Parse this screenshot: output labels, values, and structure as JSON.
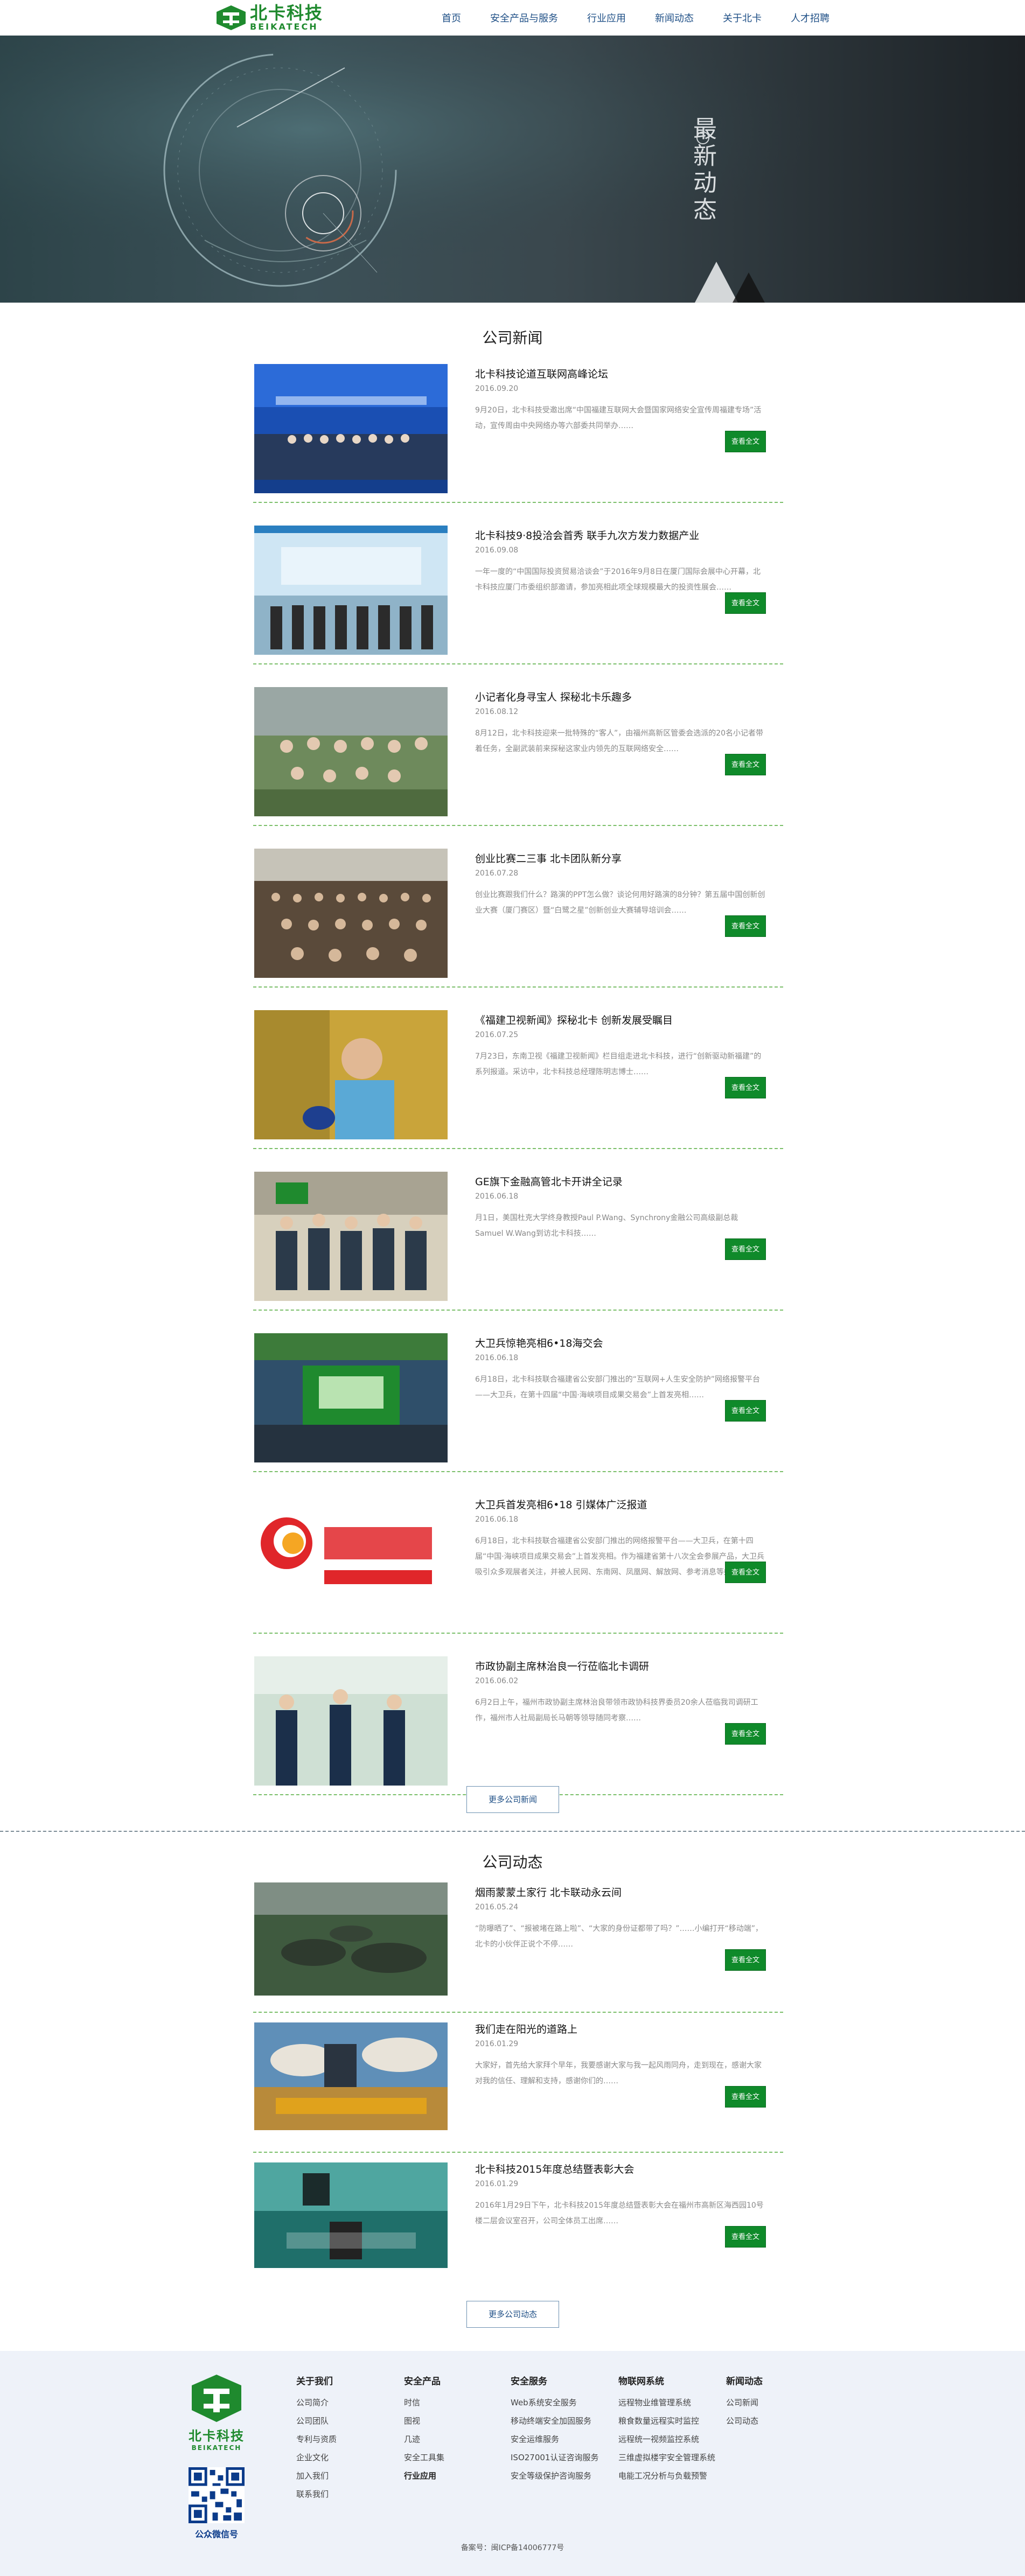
{
  "brand": {
    "name_cn": "北卡科技",
    "name_en": "BEIKATECH"
  },
  "nav": [
    {
      "label": "首页"
    },
    {
      "label": "安全产品与服务"
    },
    {
      "label": "行业应用"
    },
    {
      "label": "新闻动态"
    },
    {
      "label": "关于北卡"
    },
    {
      "label": "人才招聘"
    }
  ],
  "banner": {
    "title": "最新动态"
  },
  "company_news": {
    "title": "公司新闻",
    "more_label": "更多公司新闻",
    "read_label": "查看全文",
    "items": [
      {
        "title": "北卡科技论道互联网高峰论坛",
        "date": "2016.09.20",
        "summary": "9月20日，北卡科技受邀出席“中国福建互联网大会暨国家网络安全宣传周福建专场”活动，宣传周由中央网络办等六部委共同举办……"
      },
      {
        "title": "北卡科技9·8投洽会首秀  联手九次方发力数据产业",
        "date": "2016.09.08",
        "summary": "一年一度的“中国国际投资贸易洽谈会”于2016年9月8日在厦门国际会展中心开幕，北卡科技应厦门市委组织部邀请，参加亮相此项全球规模最大的投资性展会……"
      },
      {
        "title": "小记者化身寻宝人  探秘北卡乐趣多",
        "date": "2016.08.12",
        "summary": "8月12日，北卡科技迎来一批特殊的“客人”，由福州高新区管委会选派的20名小记者带着任务，全副武装前来探秘这家业内领先的互联网络安全……"
      },
      {
        "title": "创业比赛二三事  北卡团队新分享",
        "date": "2016.07.28",
        "summary": "创业比赛跟我们什么？路演的PPT怎么做？谈论何用好路演的8分钟？第五届中国创新创业大赛（厦门赛区）暨“白鹭之星”创新创业大赛辅导培训会……"
      },
      {
        "title": "《福建卫视新闻》探秘北卡  创新发展受瞩目",
        "date": "2016.07.25",
        "summary": "7月23日，东南卫视《福建卫视新闻》栏目组走进北卡科技，进行“创新驱动新福建”的系列报道。采访中，北卡科技总经理陈明志博士……"
      },
      {
        "title": "GE旗下金融高管北卡开讲全记录",
        "date": "2016.06.18",
        "summary": "月1日，美国杜克大学终身教授Paul P.Wang、Synchrony金融公司高级副总裁Samuel W.Wang到访北卡科技……"
      },
      {
        "title": "大卫兵惊艳亮相6•18海交会",
        "date": "2016.06.18",
        "summary": "6月18日，北卡科技联合福建省公安部门推出的“互联网+人生安全防护”网络报警平台——大卫兵，在第十四届“中国·海峡项目成果交易会”上首发亮相……"
      },
      {
        "title": "大卫兵首发亮相6•18 引媒体广泛报道",
        "date": "2016.06.18",
        "summary": "6月18日，北卡科技联合福建省公安部门推出的网络报警平台——大卫兵，在第十四届“中国·海峡项目成果交易会”上首发亮相。作为福建省第十八次全会参展产品，大卫兵吸引众多观展者关注，并被人民网、东南网、凤凰网、解放网、参考消息等媒体广泛报道与转载……"
      },
      {
        "title": "市政协副主席林治良一行莅临北卡调研",
        "date": "2016.06.02",
        "summary": "6月2日上午，福州市政协副主席林治良带领市政协科技界委员20余人莅临我司调研工作，福州市人社局副局长马朝等领导随同考察……"
      }
    ]
  },
  "company_activities": {
    "title": "公司动态",
    "more_label": "更多公司动态",
    "read_label": "查看全文",
    "items": [
      {
        "title": "烟雨蒙蒙土家行  北卡联动永云间",
        "date": "2016.05.24",
        "summary": "“防曝晒了”、“报被堵在路上啦”、“大家的身份证都带了吗？”……小编打开“移动端”，北卡的小伙伴正说个不停……"
      },
      {
        "title": "我们走在阳光的道路上",
        "date": "2016.01.29",
        "summary": "大家好，首先给大家拜个早年，我要感谢大家与我一起风雨同舟，走到现在，感谢大家对我的信任、理解和支持，感谢你们的……"
      },
      {
        "title": "北卡科技2015年度总结暨表彰大会",
        "date": "2016.01.29",
        "summary": "2016年1月29日下午，北卡科技2015年度总结暨表彰大会在福州市高新区海西园10号楼二层会议室召开，公司全体员工出席……"
      }
    ]
  },
  "footer": {
    "qr_label": "公众微信号",
    "icp": "备案号：闽ICP备14006777号",
    "columns": [
      {
        "heading": "关于我们",
        "links": [
          "公司简介",
          "公司团队",
          "专利与资质",
          "企业文化",
          "加入我们",
          "联系我们"
        ]
      },
      {
        "heading": "安全产品",
        "links": [
          "时信",
          "图视",
          "几迹",
          "安全工具集"
        ],
        "extra": "行业应用"
      },
      {
        "heading": "安全服务",
        "links": [
          "Web系统安全服务",
          "移动终端安全加固服务",
          "安全运维服务",
          "ISO27001认证咨询服务",
          "安全等级保护咨询服务"
        ]
      },
      {
        "heading": "物联网系统",
        "links": [
          "远程物业维管理系统",
          "粮食数量远程实时监控",
          "远程统一视频监控系统",
          "三维虚拟楼宇安全管理系统",
          "电能工况分析与负载预警"
        ]
      },
      {
        "heading": "新闻动态",
        "links": [
          "公司新闻",
          "公司动态"
        ]
      }
    ]
  },
  "colors": {
    "brand_green": "#1f8a2e",
    "button_green": "#0f8a2a",
    "nav_blue": "#1e4f86",
    "footer_bg": "#eef2f9"
  }
}
